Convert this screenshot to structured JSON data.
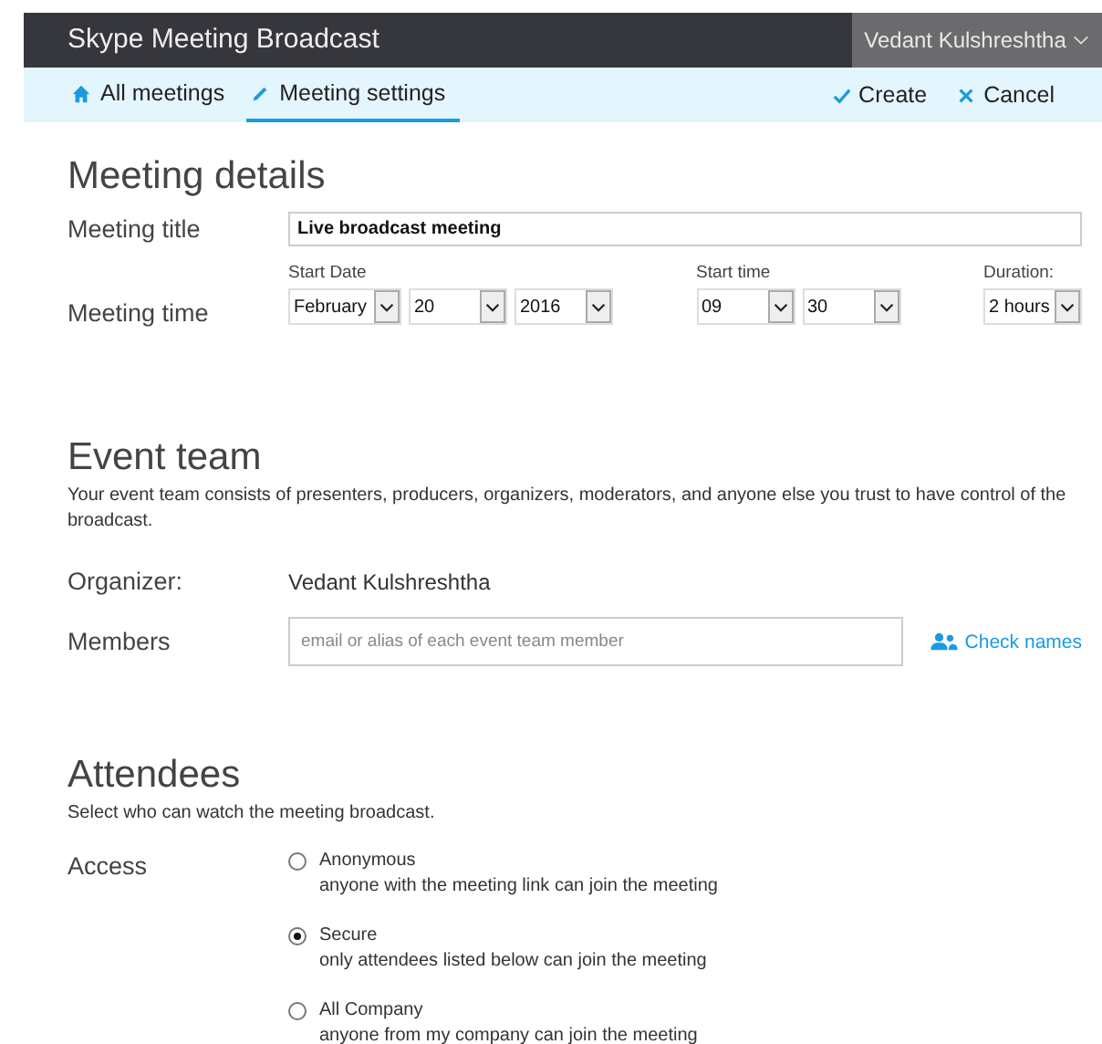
{
  "window": {
    "title": "Skype Meeting Broadcast"
  },
  "user": {
    "name": "Vedant Kulshreshtha"
  },
  "tabs": [
    {
      "label": "All meetings",
      "selected": false
    },
    {
      "label": "Meeting settings",
      "selected": true
    }
  ],
  "actions": [
    {
      "label": "Create"
    },
    {
      "label": "Cancel"
    }
  ],
  "meeting_details": {
    "heading": "Meeting details",
    "title_label": "Meeting title",
    "title_value": "Live broadcast meeting",
    "time_label": "Meeting time",
    "groups": [
      {
        "label": "Start Date",
        "selects": [
          "February",
          "20",
          "2016"
        ]
      },
      {
        "label": "Start time",
        "selects": [
          "09",
          "30"
        ]
      },
      {
        "label": "Duration:",
        "selects": [
          "2 hours"
        ]
      }
    ]
  },
  "event_team": {
    "heading": "Event team",
    "description": "Your event team consists of presenters, producers, organizers, moderators, and anyone else you trust to have control of the broadcast.",
    "organizer_label": "Organizer:",
    "organizer": "Vedant Kulshreshtha",
    "members_label": "Members",
    "members_placeholder": "email or alias of each event team member",
    "check_names": "Check names"
  },
  "attendees": {
    "heading": "Attendees",
    "description": "Select who can watch the meeting broadcast.",
    "access_label": "Access",
    "options": [
      {
        "label": "Anonymous",
        "detail": "anyone with the meeting link can join the meeting",
        "selected": false
      },
      {
        "label": "Secure",
        "detail": "only attendees listed below can join the meeting",
        "selected": true
      },
      {
        "label": "All Company",
        "detail": "anyone from my company can join the meeting",
        "selected": false
      }
    ]
  }
}
